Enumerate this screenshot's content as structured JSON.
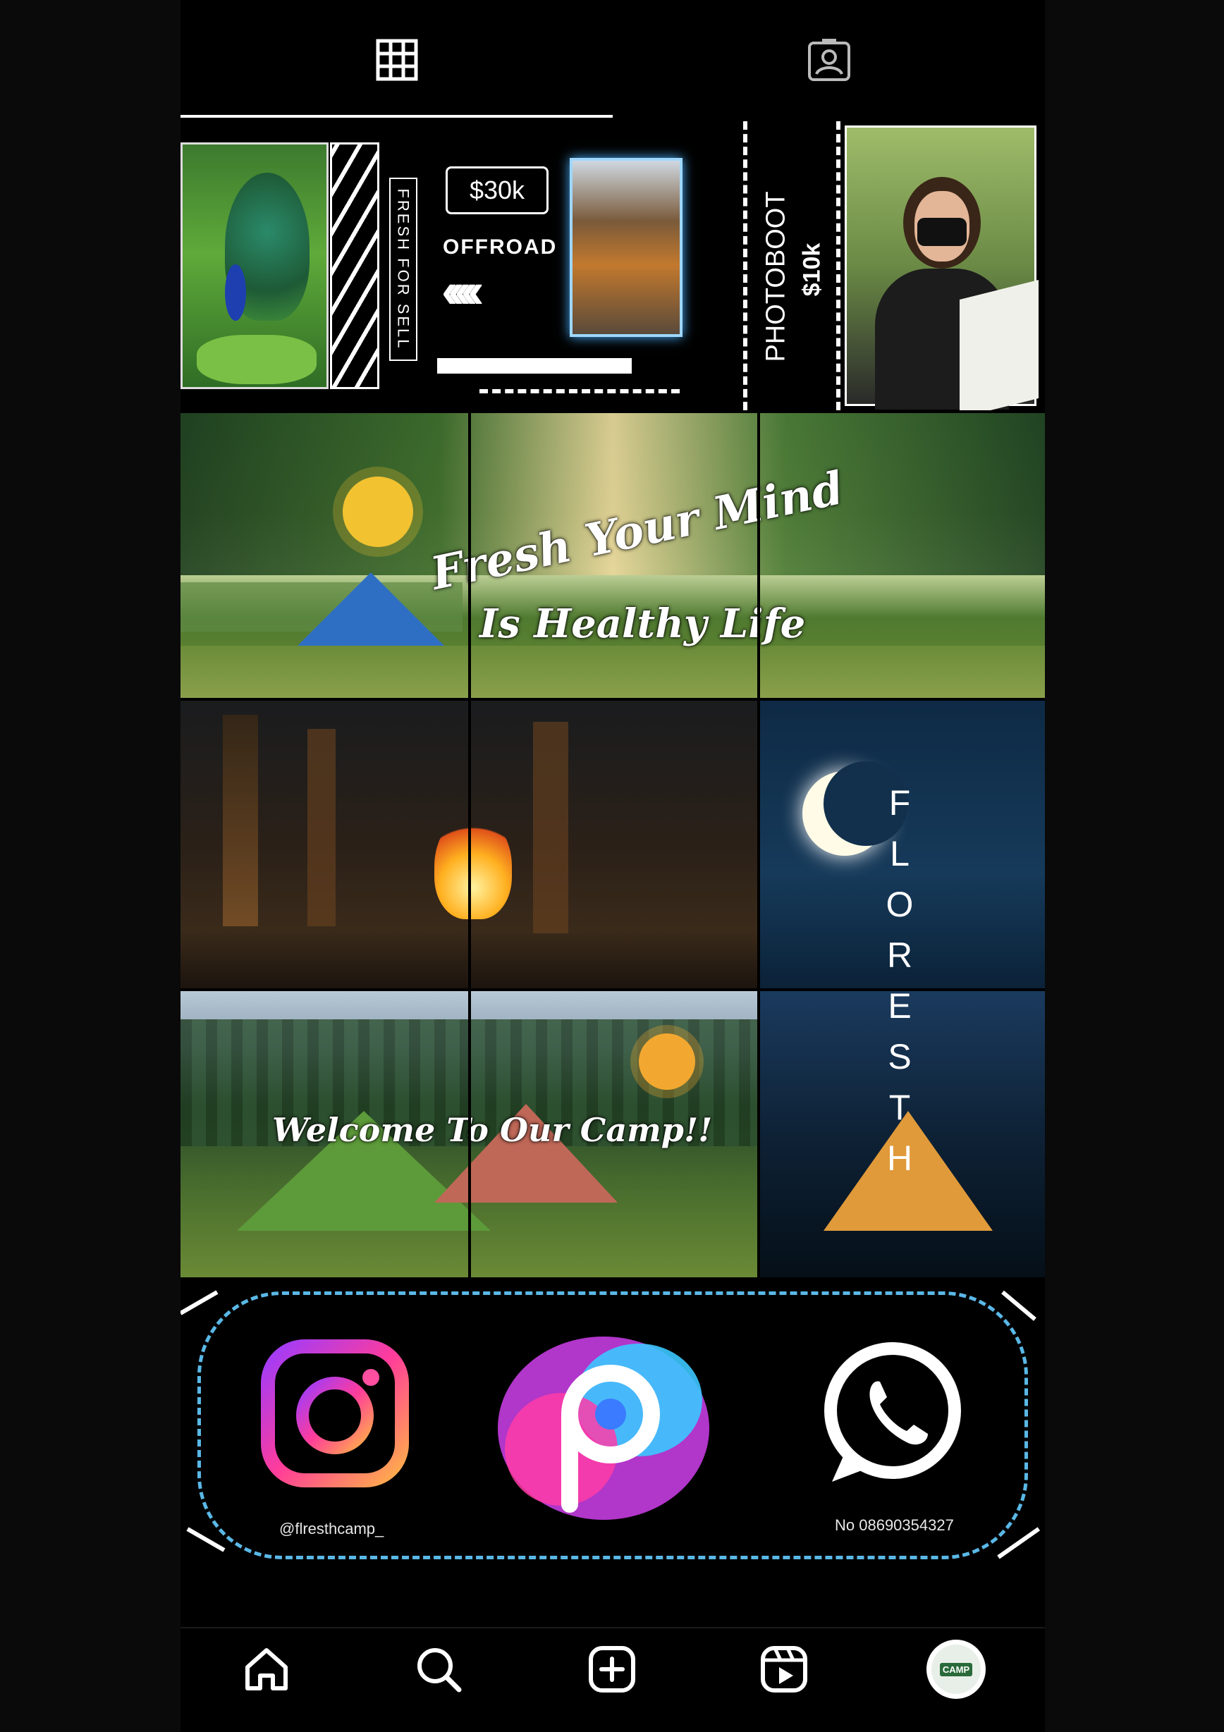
{
  "tabs": [
    {
      "id": "grid",
      "icon": "grid-icon",
      "active": true
    },
    {
      "id": "tagged",
      "icon": "tagged-user-icon",
      "active": false
    }
  ],
  "posts": {
    "row1": {
      "fresh_for_sell": "FRESH FOR SELL",
      "price_offroad": "$30k",
      "offroad_label": "OFFROAD",
      "photoboot_label": "PHOTOBOOT",
      "photoboot_price": "$10k"
    },
    "row2": {
      "headline": "Fresh Your Mind",
      "subline": "Is Healthy Life"
    },
    "row3": {
      "vertical_word": [
        "F",
        "L",
        "O",
        "R",
        "E",
        "S",
        "T",
        "H"
      ]
    },
    "row4": {
      "welcome": "Welcome To Our Camp!!"
    },
    "row5": {
      "instagram_handle": "@flresthcamp_",
      "whatsapp_number": "No 08690354327"
    }
  },
  "bottom_nav": [
    {
      "name": "home",
      "icon": "home-icon"
    },
    {
      "name": "search",
      "icon": "search-icon"
    },
    {
      "name": "create",
      "icon": "add-post-icon"
    },
    {
      "name": "reels",
      "icon": "reels-icon"
    },
    {
      "name": "profile",
      "icon": "profile-avatar",
      "avatar_text": "CAMP"
    }
  ],
  "colors": {
    "background": "#000000",
    "accent_blue": "#5ab8e6",
    "sun_yellow": "#f2c230"
  }
}
